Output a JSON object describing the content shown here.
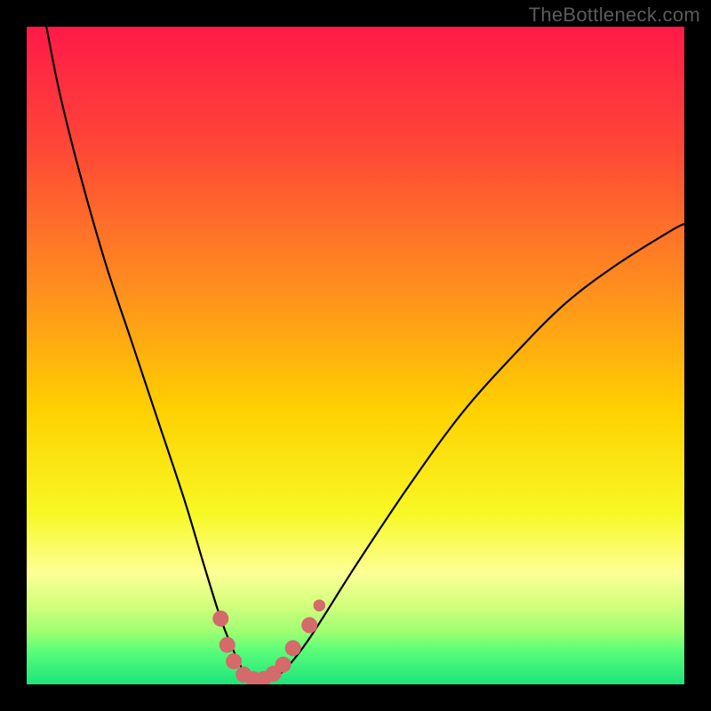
{
  "watermark": "TheBottleneck.com",
  "chart_data": {
    "type": "line",
    "title": "",
    "xlabel": "",
    "ylabel": "",
    "xlim": [
      0,
      100
    ],
    "ylim": [
      0,
      100
    ],
    "grid": false,
    "legend": false,
    "background_gradient_stops": [
      {
        "y_pct": 0,
        "color": "#ff1a48"
      },
      {
        "y_pct": 18,
        "color": "#ff4637"
      },
      {
        "y_pct": 40,
        "color": "#ff8f1e"
      },
      {
        "y_pct": 58,
        "color": "#ffd000"
      },
      {
        "y_pct": 74,
        "color": "#f7f825"
      },
      {
        "y_pct": 83,
        "color": "#fdff95"
      },
      {
        "y_pct": 88,
        "color": "#d2ff7d"
      },
      {
        "y_pct": 92,
        "color": "#9eff71"
      },
      {
        "y_pct": 95,
        "color": "#58fd79"
      },
      {
        "y_pct": 100,
        "color": "#1de47a"
      }
    ],
    "series": [
      {
        "name": "bottleneck-curve",
        "stroke": "#000000",
        "stroke_width": 2.2,
        "x": [
          3,
          5,
          8,
          12,
          16,
          20,
          24,
          27,
          29.5,
          31.5,
          33,
          34.5,
          36.5,
          39,
          43,
          50,
          58,
          66,
          74,
          82,
          90,
          98,
          100
        ],
        "y": [
          100,
          90,
          78,
          64,
          52,
          40,
          28,
          18,
          10,
          5,
          2,
          0.8,
          0.8,
          2,
          7,
          18,
          30,
          41,
          50,
          58,
          64,
          69,
          70
        ]
      }
    ],
    "markers": {
      "name": "highlight-near-minimum",
      "color": "#d46a6a",
      "radius": 9,
      "points": [
        {
          "x": 29.5,
          "y": 10.0
        },
        {
          "x": 30.5,
          "y": 6.0
        },
        {
          "x": 31.5,
          "y": 3.5
        },
        {
          "x": 33.0,
          "y": 1.5
        },
        {
          "x": 34.5,
          "y": 0.8
        },
        {
          "x": 36.0,
          "y": 0.8
        },
        {
          "x": 37.5,
          "y": 1.6
        },
        {
          "x": 39.0,
          "y": 3.0
        },
        {
          "x": 40.5,
          "y": 5.5
        },
        {
          "x": 43.0,
          "y": 9.0
        }
      ],
      "isolated_point": {
        "x": 44.5,
        "y": 12.0
      }
    }
  }
}
